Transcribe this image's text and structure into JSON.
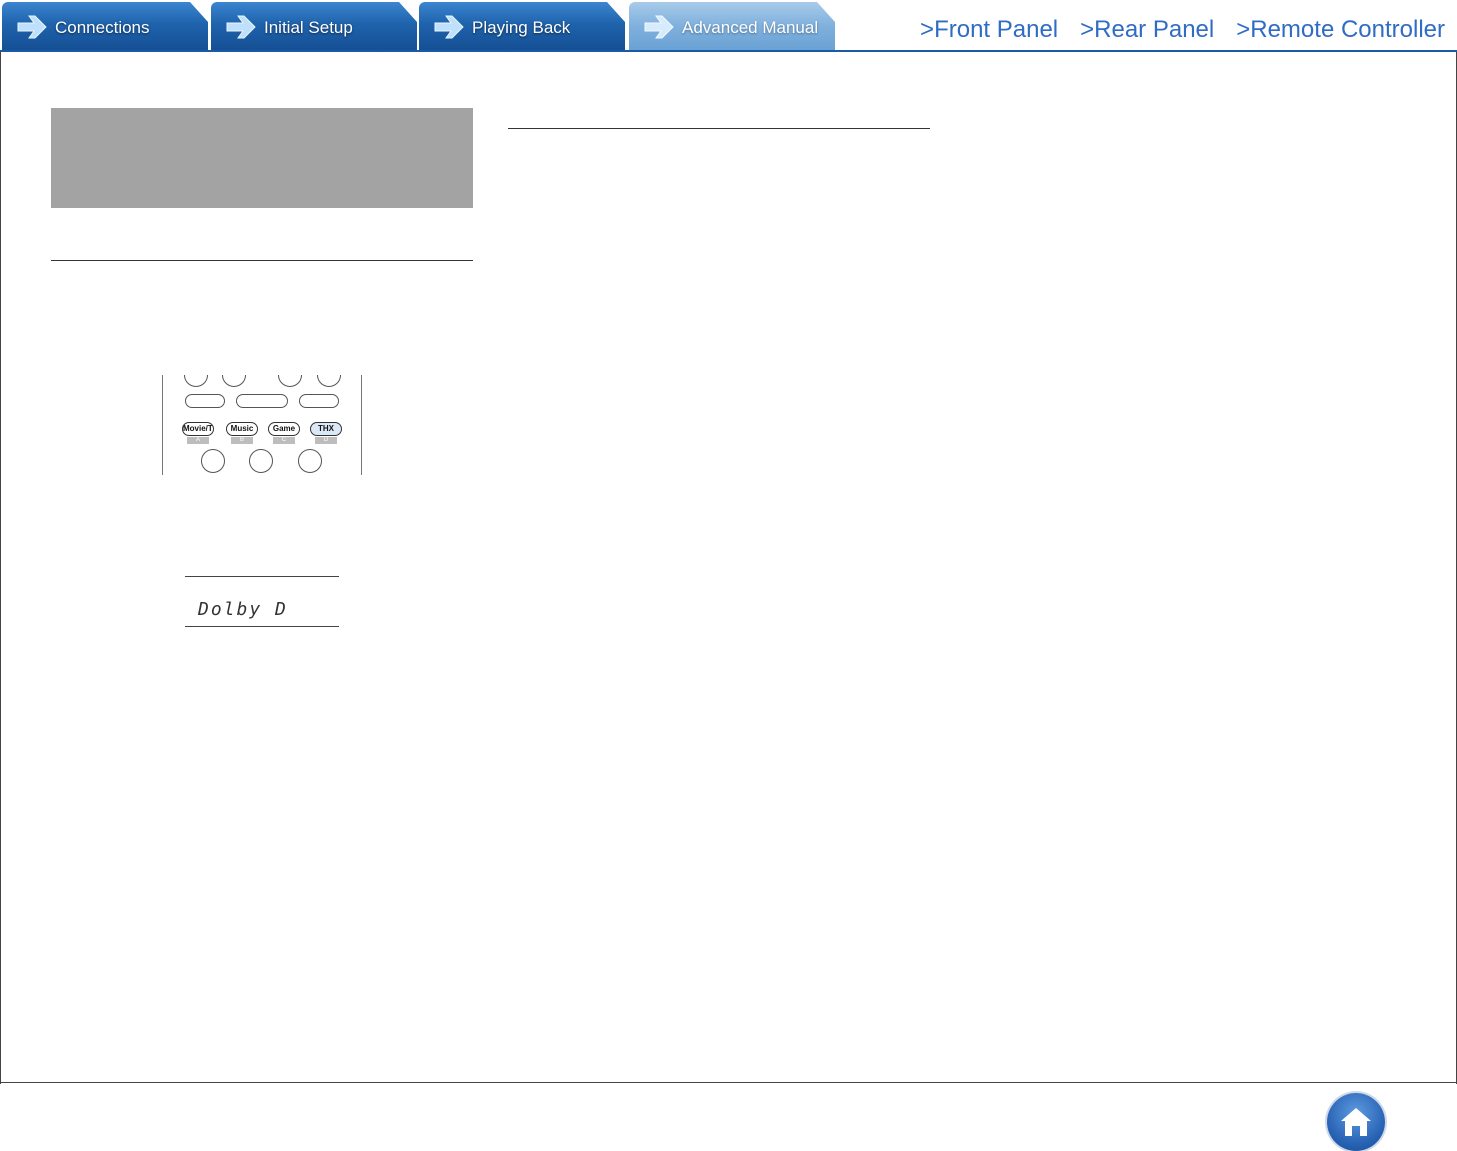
{
  "tabs": [
    {
      "label": "Connections",
      "active": false
    },
    {
      "label": "Initial Setup",
      "active": false
    },
    {
      "label": "Playing Back",
      "active": false
    },
    {
      "label": "Advanced Manual",
      "active": true
    }
  ],
  "quick_links": [
    {
      "label": ">Front Panel"
    },
    {
      "label": ">Rear Panel"
    },
    {
      "label": ">Remote Controller"
    }
  ],
  "remote": {
    "mode_buttons": [
      {
        "label": "Movie/TV",
        "tag": "A"
      },
      {
        "label": "Music",
        "tag": "B"
      },
      {
        "label": "Game",
        "tag": "C"
      },
      {
        "label": "THX",
        "tag": "D"
      }
    ]
  },
  "display": {
    "text": "Dolby D"
  },
  "colors": {
    "tab_blue": "#1f63ad",
    "tab_active": "#7fb0dd",
    "link_blue": "#2f6cc4",
    "home_blue": "#2762b3",
    "gray_box": "#a3a3a3"
  },
  "icons": {
    "tab_arrow": "arrow-right-icon",
    "home": "home-icon"
  }
}
